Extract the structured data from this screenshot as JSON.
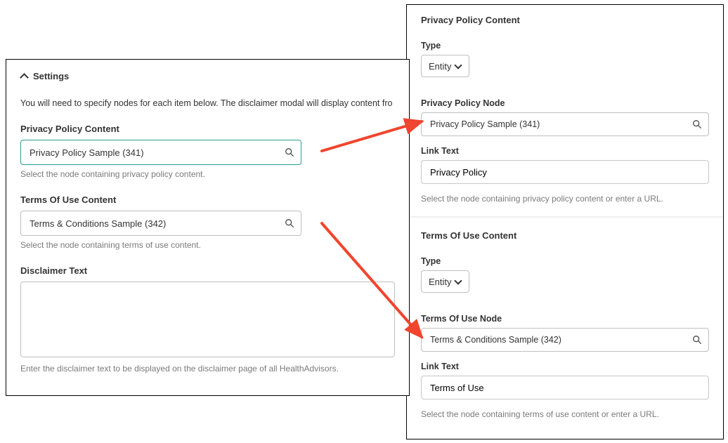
{
  "left": {
    "settings_title": "Settings",
    "intro": "You will need to specify nodes for each item below. The disclaimer modal will display content fro",
    "privacy": {
      "label": "Privacy Policy Content",
      "value": "Privacy Policy Sample (341)",
      "helper": "Select the node containing privacy policy content."
    },
    "terms": {
      "label": "Terms Of Use Content",
      "value": "Terms & Conditions Sample (342)",
      "helper": "Select the node containing terms of use content."
    },
    "disclaimer": {
      "label": "Disclaimer Text",
      "value": "",
      "helper": "Enter the disclaimer text to be displayed on the disclaimer page of all HealthAdvisors."
    }
  },
  "right": {
    "privacy": {
      "section_title": "Privacy Policy Content",
      "type_label": "Type",
      "type_value": "Entity",
      "node_label": "Privacy Policy Node",
      "node_value": "Privacy Policy Sample (341)",
      "link_label": "Link Text",
      "link_value": "Privacy Policy",
      "helper": "Select the node containing privacy policy content or enter a URL."
    },
    "terms": {
      "section_title": "Terms Of Use Content",
      "type_label": "Type",
      "type_value": "Entity",
      "node_label": "Terms Of Use Node",
      "node_value": "Terms & Conditions Sample (342)",
      "link_label": "Link Text",
      "link_value": "Terms of Use",
      "helper": "Select the node containing terms of use content or enter a URL."
    }
  }
}
